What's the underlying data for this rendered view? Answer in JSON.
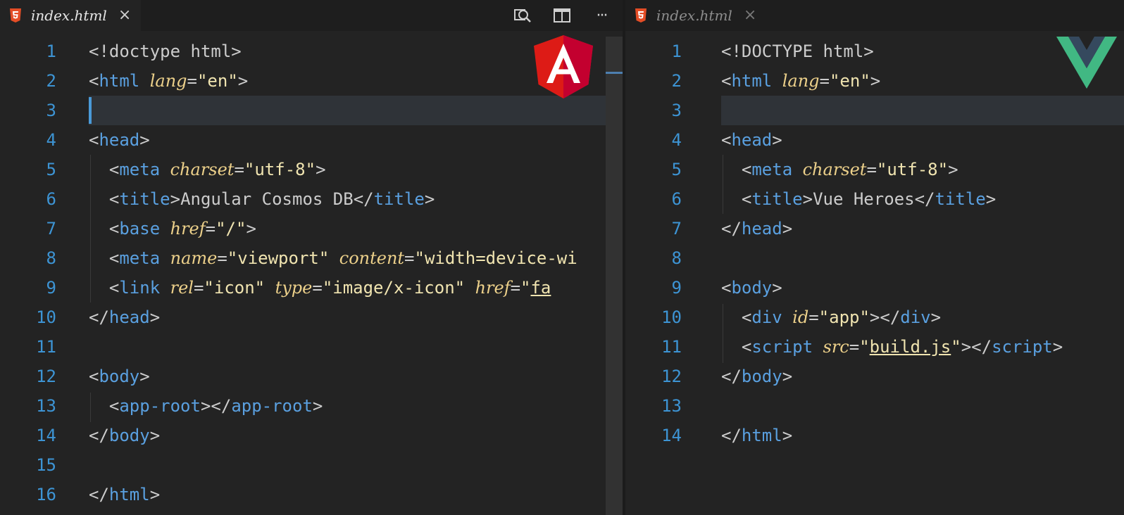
{
  "left_editor": {
    "tab": {
      "label": "index.html",
      "close": "×",
      "file_icon": "html5-icon"
    },
    "actions": [
      {
        "name": "open-changes-button",
        "icon": "search-diff-icon"
      },
      {
        "name": "split-editor-button",
        "icon": "split-editor-icon"
      },
      {
        "name": "more-actions-button",
        "icon": "ellipsis-icon",
        "label": "···"
      }
    ],
    "logo": {
      "name": "angular-logo",
      "letter": "A",
      "color": "#dd1b16"
    },
    "line_numbers": [
      "1",
      "2",
      "3",
      "4",
      "5",
      "6",
      "7",
      "8",
      "9",
      "10",
      "11",
      "12",
      "13",
      "14",
      "15",
      "16"
    ],
    "lines": [
      [
        [
          "p",
          "<!doctype html>"
        ]
      ],
      [
        [
          "p",
          "<"
        ],
        [
          "t",
          "html"
        ],
        [
          "p",
          " "
        ],
        [
          "a",
          "lang"
        ],
        [
          "p",
          "="
        ],
        [
          "s",
          "\"en\""
        ],
        [
          "p",
          ">"
        ]
      ],
      [],
      [
        [
          "p",
          "<"
        ],
        [
          "t",
          "head"
        ],
        [
          "p",
          ">"
        ]
      ],
      [
        [
          "p",
          "  <"
        ],
        [
          "t",
          "meta"
        ],
        [
          "p",
          " "
        ],
        [
          "a",
          "charset"
        ],
        [
          "p",
          "="
        ],
        [
          "s",
          "\"utf-8\""
        ],
        [
          "p",
          ">"
        ]
      ],
      [
        [
          "p",
          "  <"
        ],
        [
          "t",
          "title"
        ],
        [
          "p",
          ">"
        ],
        [
          "p",
          "Angular Cosmos DB"
        ],
        [
          "p",
          "</"
        ],
        [
          "t",
          "title"
        ],
        [
          "p",
          ">"
        ]
      ],
      [
        [
          "p",
          "  <"
        ],
        [
          "t",
          "base"
        ],
        [
          "p",
          " "
        ],
        [
          "a",
          "href"
        ],
        [
          "p",
          "="
        ],
        [
          "s",
          "\"/\""
        ],
        [
          "p",
          ">"
        ]
      ],
      [
        [
          "p",
          "  <"
        ],
        [
          "t",
          "meta"
        ],
        [
          "p",
          " "
        ],
        [
          "a",
          "name"
        ],
        [
          "p",
          "="
        ],
        [
          "s",
          "\"viewport\""
        ],
        [
          "p",
          " "
        ],
        [
          "a",
          "content"
        ],
        [
          "p",
          "="
        ],
        [
          "s",
          "\"width=device-wi"
        ]
      ],
      [
        [
          "p",
          "  <"
        ],
        [
          "t",
          "link"
        ],
        [
          "p",
          " "
        ],
        [
          "a",
          "rel"
        ],
        [
          "p",
          "="
        ],
        [
          "s",
          "\"icon\""
        ],
        [
          "p",
          " "
        ],
        [
          "a",
          "type"
        ],
        [
          "p",
          "="
        ],
        [
          "s",
          "\"image/x-icon\""
        ],
        [
          "p",
          " "
        ],
        [
          "a",
          "href"
        ],
        [
          "p",
          "="
        ],
        [
          "s",
          "\""
        ],
        [
          "su",
          "fa"
        ]
      ],
      [
        [
          "p",
          "</"
        ],
        [
          "t",
          "head"
        ],
        [
          "p",
          ">"
        ]
      ],
      [],
      [
        [
          "p",
          "<"
        ],
        [
          "t",
          "body"
        ],
        [
          "p",
          ">"
        ]
      ],
      [
        [
          "p",
          "  <"
        ],
        [
          "t",
          "app-root"
        ],
        [
          "p",
          ">"
        ],
        [
          "p",
          "</"
        ],
        [
          "t",
          "app-root"
        ],
        [
          "p",
          ">"
        ]
      ],
      [
        [
          "p",
          "</"
        ],
        [
          "t",
          "body"
        ],
        [
          "p",
          ">"
        ]
      ],
      [],
      [
        [
          "p",
          "</"
        ],
        [
          "t",
          "html"
        ],
        [
          "p",
          ">"
        ]
      ]
    ]
  },
  "right_editor": {
    "tab": {
      "label": "index.html",
      "close": "×",
      "file_icon": "html5-icon"
    },
    "logo": {
      "name": "vue-logo",
      "color_outer": "#41b883",
      "color_inner": "#35495e"
    },
    "line_numbers": [
      "1",
      "2",
      "3",
      "4",
      "5",
      "6",
      "7",
      "8",
      "9",
      "10",
      "11",
      "12",
      "13",
      "14"
    ],
    "lines": [
      [
        [
          "p",
          "<!DOCTYPE html>"
        ]
      ],
      [
        [
          "p",
          "<"
        ],
        [
          "t",
          "html"
        ],
        [
          "p",
          " "
        ],
        [
          "a",
          "lang"
        ],
        [
          "p",
          "="
        ],
        [
          "s",
          "\"en\""
        ],
        [
          "p",
          ">"
        ]
      ],
      [],
      [
        [
          "p",
          "<"
        ],
        [
          "t",
          "head"
        ],
        [
          "p",
          ">"
        ]
      ],
      [
        [
          "p",
          "  <"
        ],
        [
          "t",
          "meta"
        ],
        [
          "p",
          " "
        ],
        [
          "a",
          "charset"
        ],
        [
          "p",
          "="
        ],
        [
          "s",
          "\"utf-8\""
        ],
        [
          "p",
          ">"
        ]
      ],
      [
        [
          "p",
          "  <"
        ],
        [
          "t",
          "title"
        ],
        [
          "p",
          ">"
        ],
        [
          "p",
          "Vue Heroes"
        ],
        [
          "p",
          "</"
        ],
        [
          "t",
          "title"
        ],
        [
          "p",
          ">"
        ]
      ],
      [
        [
          "p",
          "</"
        ],
        [
          "t",
          "head"
        ],
        [
          "p",
          ">"
        ]
      ],
      [],
      [
        [
          "p",
          "<"
        ],
        [
          "t",
          "body"
        ],
        [
          "p",
          ">"
        ]
      ],
      [
        [
          "p",
          "  <"
        ],
        [
          "t",
          "div"
        ],
        [
          "p",
          " "
        ],
        [
          "a",
          "id"
        ],
        [
          "p",
          "="
        ],
        [
          "s",
          "\"app\""
        ],
        [
          "p",
          ">"
        ],
        [
          "p",
          "</"
        ],
        [
          "t",
          "div"
        ],
        [
          "p",
          ">"
        ]
      ],
      [
        [
          "p",
          "  <"
        ],
        [
          "t",
          "script"
        ],
        [
          "p",
          " "
        ],
        [
          "a",
          "src"
        ],
        [
          "p",
          "="
        ],
        [
          "s",
          "\""
        ],
        [
          "su",
          "build.js"
        ],
        [
          "s",
          "\""
        ],
        [
          "p",
          ">"
        ],
        [
          "p",
          "</"
        ],
        [
          "t",
          "script"
        ],
        [
          "p",
          ">"
        ]
      ],
      [
        [
          "p",
          "</"
        ],
        [
          "t",
          "body"
        ],
        [
          "p",
          ">"
        ]
      ],
      [],
      [
        [
          "p",
          "</"
        ],
        [
          "t",
          "html"
        ],
        [
          "p",
          ">"
        ]
      ]
    ]
  }
}
